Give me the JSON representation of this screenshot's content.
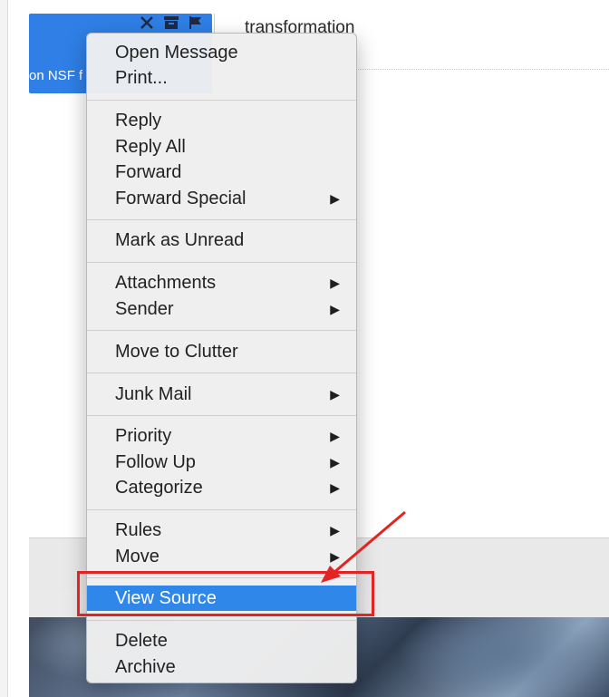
{
  "background": {
    "message_snippet": "on NSF f",
    "subject": "transformation",
    "icons": [
      "close-icon",
      "archive-icon",
      "flag-icon"
    ]
  },
  "context_menu": {
    "groups": [
      [
        {
          "label": "Open Message"
        },
        {
          "label": "Print..."
        }
      ],
      [
        {
          "label": "Reply"
        },
        {
          "label": "Reply All"
        },
        {
          "label": "Forward"
        },
        {
          "label": "Forward Special",
          "submenu": true
        }
      ],
      [
        {
          "label": "Mark as Unread"
        }
      ],
      [
        {
          "label": "Attachments",
          "submenu": true
        },
        {
          "label": "Sender",
          "submenu": true
        }
      ],
      [
        {
          "label": "Move to Clutter"
        }
      ],
      [
        {
          "label": "Junk Mail",
          "submenu": true
        }
      ],
      [
        {
          "label": "Priority",
          "submenu": true
        },
        {
          "label": "Follow Up",
          "submenu": true
        },
        {
          "label": "Categorize",
          "submenu": true
        }
      ],
      [
        {
          "label": "Rules",
          "submenu": true
        },
        {
          "label": "Move",
          "submenu": true
        }
      ],
      [
        {
          "label": "View Source",
          "highlighted": true
        }
      ],
      [
        {
          "label": "Delete"
        },
        {
          "label": "Archive"
        }
      ]
    ],
    "submenu_arrow": "▶"
  },
  "annotation": {
    "color": "#e32424",
    "target": "View Source"
  },
  "colors": {
    "selection_blue": "#2f7fe6",
    "menu_highlight": "#2f87ea"
  }
}
